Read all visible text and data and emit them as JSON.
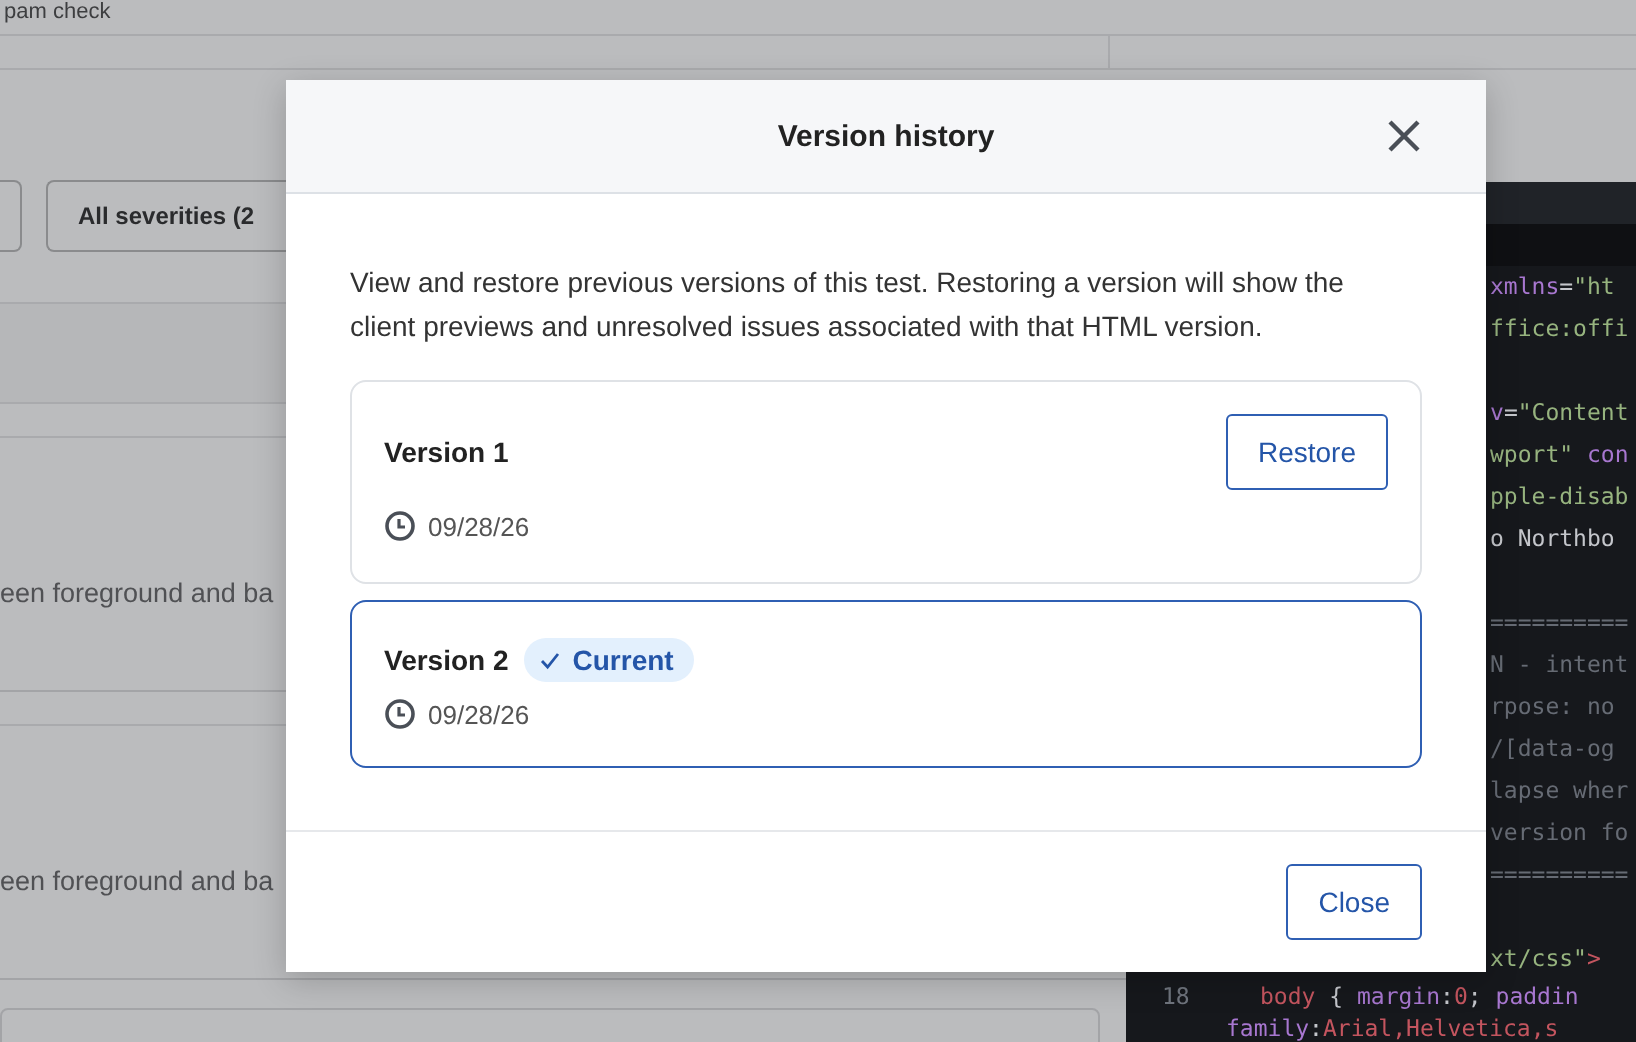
{
  "background": {
    "header_text": "pam check",
    "filter_label": "All severities (2",
    "issue_cards": [
      {
        "text": "een foreground and ba"
      },
      {
        "text": "een foreground and ba"
      }
    ],
    "code_lines": [
      {
        "kind": "tail",
        "tokens": [
          {
            "t": "xmlns",
            "kind": "attr"
          },
          {
            "t": "=",
            "kind": "punct"
          },
          {
            "t": "\"ht",
            "kind": "string"
          }
        ]
      },
      {
        "kind": "tail",
        "tokens": [
          {
            "t": "ffice:offi",
            "kind": "string"
          }
        ]
      },
      {
        "kind": "blank"
      },
      {
        "kind": "tail",
        "tokens": [
          {
            "t": "v",
            "kind": "attr"
          },
          {
            "t": "=",
            "kind": "punct"
          },
          {
            "t": "\"Content",
            "kind": "string"
          }
        ]
      },
      {
        "kind": "tail",
        "tokens": [
          {
            "t": "wport\"",
            "kind": "string"
          },
          {
            "t": " con",
            "kind": "attr"
          }
        ]
      },
      {
        "kind": "tail",
        "tokens": [
          {
            "t": "pple-disab",
            "kind": "string"
          }
        ]
      },
      {
        "kind": "tail",
        "tokens": [
          {
            "t": "o Northbo",
            "kind": "text"
          }
        ]
      },
      {
        "kind": "blank"
      },
      {
        "kind": "tail",
        "tokens": [
          {
            "t": "==========",
            "kind": "comment"
          }
        ]
      },
      {
        "kind": "tail",
        "tokens": [
          {
            "t": "N - intent",
            "kind": "comment"
          }
        ]
      },
      {
        "kind": "tail",
        "tokens": [
          {
            "t": "rpose: no",
            "kind": "comment"
          }
        ]
      },
      {
        "kind": "tail",
        "tokens": [
          {
            "t": "/[data-og",
            "kind": "comment"
          }
        ]
      },
      {
        "kind": "tail",
        "tokens": [
          {
            "t": "lapse wher",
            "kind": "comment"
          }
        ]
      },
      {
        "kind": "tail",
        "tokens": [
          {
            "t": "version fo",
            "kind": "comment"
          }
        ]
      },
      {
        "kind": "tail",
        "tokens": [
          {
            "t": "==========",
            "kind": "comment"
          }
        ]
      },
      {
        "kind": "blank"
      },
      {
        "kind": "tail",
        "tokens": [
          {
            "t": "xt/css\"",
            "kind": "string"
          },
          {
            "t": ">",
            "kind": "tag"
          }
        ]
      },
      {
        "kind": "numbered",
        "number": "18",
        "tokens": [
          {
            "t": "body",
            "kind": "tag"
          },
          {
            "t": " { ",
            "kind": "punct"
          },
          {
            "t": "margin",
            "kind": "attr"
          },
          {
            "t": ":",
            "kind": "punct"
          },
          {
            "t": "0",
            "kind": "number"
          },
          {
            "t": "; ",
            "kind": "punct"
          },
          {
            "t": "paddin",
            "kind": "attr"
          }
        ]
      },
      {
        "kind": "wrap",
        "tokens": [
          {
            "t": "family",
            "kind": "attr"
          },
          {
            "t": ":",
            "kind": "punct"
          },
          {
            "t": "Arial,Helvetica,s",
            "kind": "tag"
          }
        ]
      }
    ]
  },
  "dialog": {
    "title": "Version history",
    "description": "View and restore previous versions of this test. Restoring a version will show the client previews and unresolved issues associated with that HTML version.",
    "versions": [
      {
        "name": "Version 1",
        "date": "09/28/26",
        "current": false,
        "action": "Restore"
      },
      {
        "name": "Version 2",
        "date": "09/28/26",
        "current": true,
        "badge": "Current"
      }
    ],
    "footer_button": "Close"
  }
}
